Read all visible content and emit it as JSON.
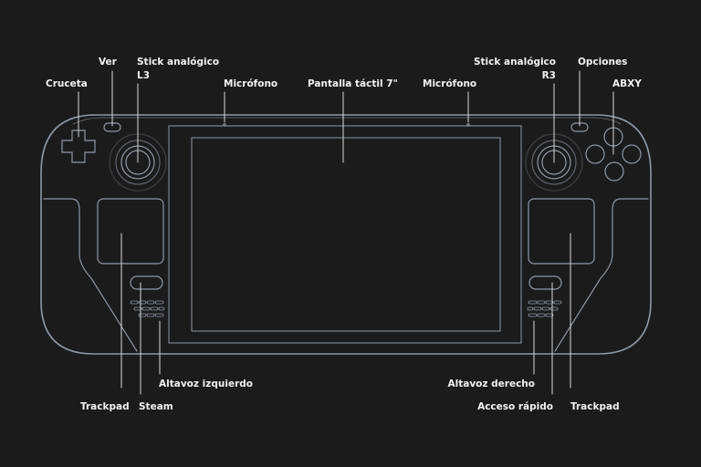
{
  "colors": {
    "background": "#1b1b1b",
    "outline": "#9aa3ad",
    "leader": "#d8d8d8",
    "text": "#f2f2f2"
  },
  "labels": {
    "dpad": "Cruceta",
    "view": "Ver",
    "left_stick": [
      "Stick analógico",
      "L3"
    ],
    "mic_left": "Micrófono",
    "screen": "Pantalla táctil 7\"",
    "mic_right": "Micrófono",
    "right_stick": [
      "Stick analógico",
      "R3"
    ],
    "options": "Opciones",
    "abxy": "ABXY",
    "trackpad_left": "Trackpad",
    "steam": "Steam",
    "speaker_left": "Altavoz izquierdo",
    "speaker_right": "Altavoz derecho",
    "quick_access": "Acceso rápido",
    "trackpad_right": "Trackpad"
  }
}
